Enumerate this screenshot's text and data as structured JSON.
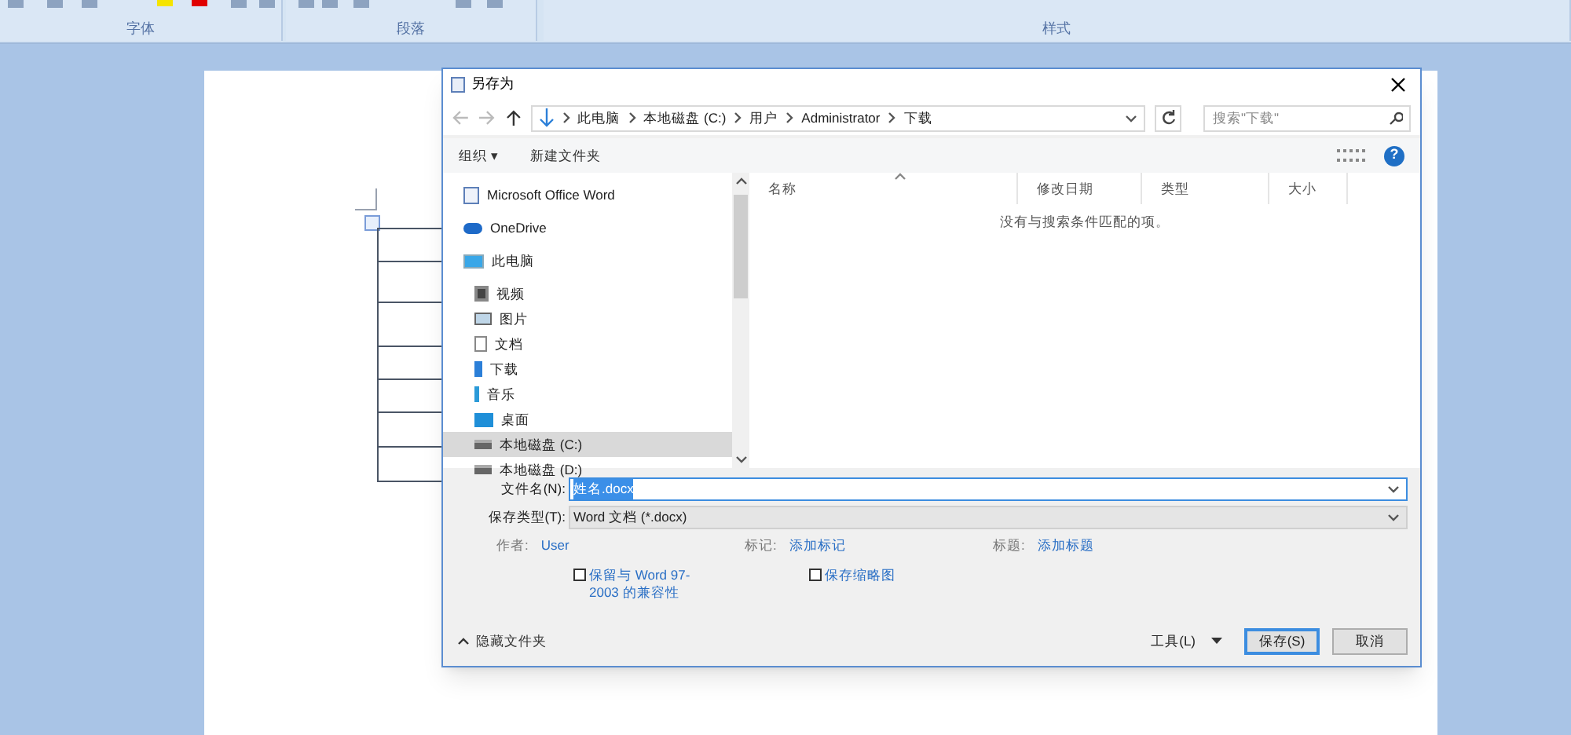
{
  "ribbon": {
    "groups": [
      {
        "label": "字体"
      },
      {
        "label": "段落"
      },
      {
        "label": "样式"
      }
    ]
  },
  "dialog": {
    "title": "另存为",
    "address": {
      "path": [
        "此电脑",
        "本地磁盘 (C:)",
        "用户",
        "Administrator",
        "下载"
      ],
      "search_placeholder": "搜索\"下载\""
    },
    "toolbar": {
      "organize": "组织 ▾",
      "new_folder": "新建文件夹",
      "help": "?"
    },
    "nav": [
      {
        "label": "Microsoft Office Word",
        "kind": "app",
        "selected": false
      },
      {
        "label": "OneDrive",
        "kind": "cloud",
        "selected": false
      },
      {
        "label": "此电脑",
        "kind": "pc",
        "selected": false,
        "children": [
          {
            "label": "视频",
            "kind": "video",
            "selected": false
          },
          {
            "label": "图片",
            "kind": "image",
            "selected": false
          },
          {
            "label": "文档",
            "kind": "doc",
            "selected": false
          },
          {
            "label": "下载",
            "kind": "download",
            "selected": false
          },
          {
            "label": "音乐",
            "kind": "music",
            "selected": false
          },
          {
            "label": "桌面",
            "kind": "desktop",
            "selected": false
          },
          {
            "label": "本地磁盘 (C:)",
            "kind": "drive",
            "selected": true
          },
          {
            "label": "本地磁盘 (D:)",
            "kind": "drive",
            "selected": false
          }
        ]
      }
    ],
    "columns": [
      "名称",
      "修改日期",
      "类型",
      "大小"
    ],
    "empty_message": "没有与搜索条件匹配的项。",
    "filename": {
      "label": "文件名(N):",
      "value": "姓名.docx"
    },
    "filetype": {
      "label": "保存类型(T):",
      "value": "Word 文档 (*.docx)"
    },
    "meta": [
      {
        "label": "作者:",
        "value": "User"
      },
      {
        "label": "标记:",
        "value": "添加标记"
      },
      {
        "label": "标题:",
        "value": "添加标题"
      }
    ],
    "options": [
      {
        "label": "保留与 Word 97-2003 的兼容性",
        "checked": false
      },
      {
        "label": "保存缩略图",
        "checked": false
      }
    ],
    "hide_folders": "隐藏文件夹",
    "tools": "工具(L)",
    "save": "保存(S)",
    "cancel": "取消"
  }
}
